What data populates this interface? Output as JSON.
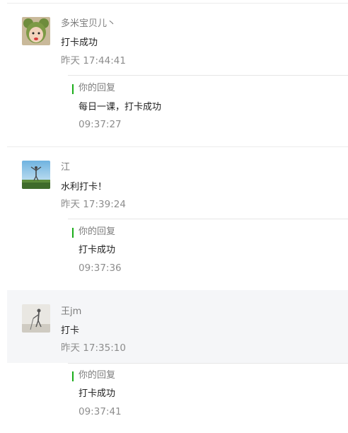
{
  "comments": [
    {
      "nickname": "多米宝贝儿丶",
      "content": "打卡成功",
      "time": "昨天 17:44:41",
      "avatar_icon": "child-photo-avatar",
      "reply": {
        "label": "你的回复",
        "content": "每日一课，打卡成功",
        "time": "09:37:27"
      }
    },
    {
      "nickname": "江",
      "content": "水利打卡！",
      "time": "昨天 17:39:24",
      "avatar_icon": "landscape-photo-avatar",
      "reply": {
        "label": "你的回复",
        "content": "打卡成功",
        "time": "09:37:36"
      }
    },
    {
      "nickname": "王jm",
      "content": "打卡",
      "time": "昨天 17:35:10",
      "avatar_icon": "person-sketch-avatar",
      "reply": {
        "label": "你的回复",
        "content": "打卡成功",
        "time": "09:37:41"
      }
    }
  ],
  "colors": {
    "reply_accent": "#1aad19",
    "highlight_bg": "#f5f6f8"
  }
}
